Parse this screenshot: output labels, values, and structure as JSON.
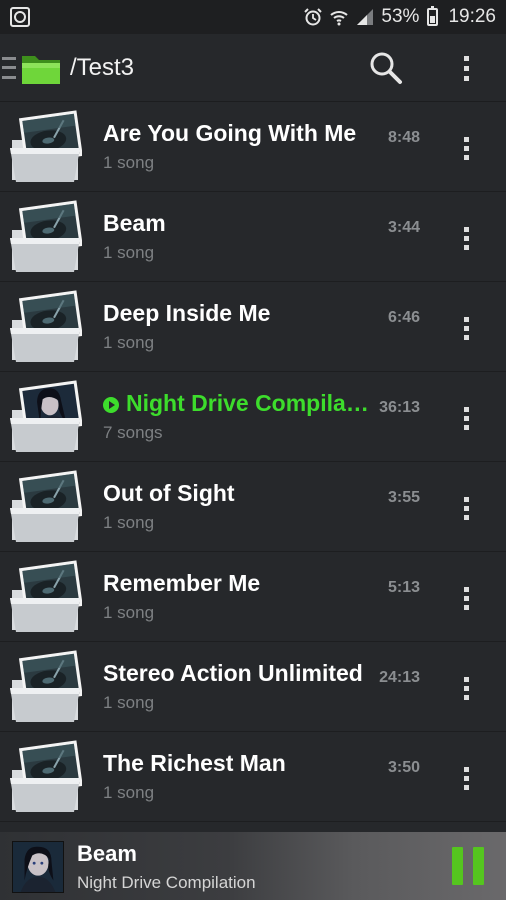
{
  "status_bar": {
    "battery": "53%",
    "time": "19:26"
  },
  "app_bar": {
    "path": "/Test3"
  },
  "folders": [
    {
      "title": "Are You Going With Me",
      "subtitle": "1 song",
      "duration": "8:48",
      "art": "turntable"
    },
    {
      "title": "Beam",
      "subtitle": "1 song",
      "duration": "3:44",
      "art": "turntable"
    },
    {
      "title": "Deep Inside Me",
      "subtitle": "1 song",
      "duration": "6:46",
      "art": "turntable"
    },
    {
      "title": "Night Drive Compilati..",
      "subtitle": "7 songs",
      "duration": "36:13",
      "art": "portrait",
      "playing": true
    },
    {
      "title": "Out of Sight",
      "subtitle": "1 song",
      "duration": "3:55",
      "art": "turntable"
    },
    {
      "title": "Remember Me",
      "subtitle": "1 song",
      "duration": "5:13",
      "art": "turntable"
    },
    {
      "title": "Stereo Action Unlimited",
      "subtitle": "1 song",
      "duration": "24:13",
      "art": "turntable"
    },
    {
      "title": "The Richest Man",
      "subtitle": "1 song",
      "duration": "3:50",
      "art": "turntable"
    }
  ],
  "now_playing": {
    "title": "Beam",
    "subtitle": "Night Drive Compilation"
  },
  "colors": {
    "accent": "#3ddd2c",
    "pause": "#55c51f",
    "background": "#26282b"
  }
}
